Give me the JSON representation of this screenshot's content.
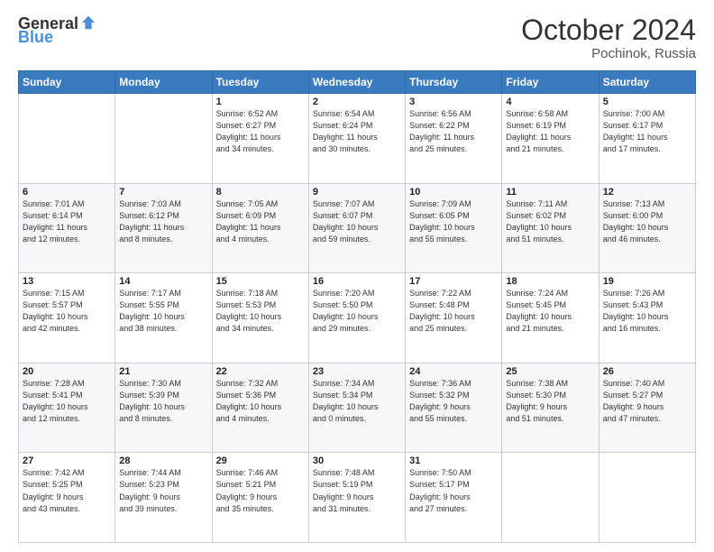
{
  "header": {
    "logo": {
      "general": "General",
      "blue": "Blue"
    },
    "title": "October 2024",
    "location": "Pochinok, Russia"
  },
  "calendar": {
    "days_of_week": [
      "Sunday",
      "Monday",
      "Tuesday",
      "Wednesday",
      "Thursday",
      "Friday",
      "Saturday"
    ],
    "weeks": [
      [
        {
          "day": "",
          "text": ""
        },
        {
          "day": "",
          "text": ""
        },
        {
          "day": "1",
          "text": "Sunrise: 6:52 AM\nSunset: 6:27 PM\nDaylight: 11 hours\nand 34 minutes."
        },
        {
          "day": "2",
          "text": "Sunrise: 6:54 AM\nSunset: 6:24 PM\nDaylight: 11 hours\nand 30 minutes."
        },
        {
          "day": "3",
          "text": "Sunrise: 6:56 AM\nSunset: 6:22 PM\nDaylight: 11 hours\nand 25 minutes."
        },
        {
          "day": "4",
          "text": "Sunrise: 6:58 AM\nSunset: 6:19 PM\nDaylight: 11 hours\nand 21 minutes."
        },
        {
          "day": "5",
          "text": "Sunrise: 7:00 AM\nSunset: 6:17 PM\nDaylight: 11 hours\nand 17 minutes."
        }
      ],
      [
        {
          "day": "6",
          "text": "Sunrise: 7:01 AM\nSunset: 6:14 PM\nDaylight: 11 hours\nand 12 minutes."
        },
        {
          "day": "7",
          "text": "Sunrise: 7:03 AM\nSunset: 6:12 PM\nDaylight: 11 hours\nand 8 minutes."
        },
        {
          "day": "8",
          "text": "Sunrise: 7:05 AM\nSunset: 6:09 PM\nDaylight: 11 hours\nand 4 minutes."
        },
        {
          "day": "9",
          "text": "Sunrise: 7:07 AM\nSunset: 6:07 PM\nDaylight: 10 hours\nand 59 minutes."
        },
        {
          "day": "10",
          "text": "Sunrise: 7:09 AM\nSunset: 6:05 PM\nDaylight: 10 hours\nand 55 minutes."
        },
        {
          "day": "11",
          "text": "Sunrise: 7:11 AM\nSunset: 6:02 PM\nDaylight: 10 hours\nand 51 minutes."
        },
        {
          "day": "12",
          "text": "Sunrise: 7:13 AM\nSunset: 6:00 PM\nDaylight: 10 hours\nand 46 minutes."
        }
      ],
      [
        {
          "day": "13",
          "text": "Sunrise: 7:15 AM\nSunset: 5:57 PM\nDaylight: 10 hours\nand 42 minutes."
        },
        {
          "day": "14",
          "text": "Sunrise: 7:17 AM\nSunset: 5:55 PM\nDaylight: 10 hours\nand 38 minutes."
        },
        {
          "day": "15",
          "text": "Sunrise: 7:18 AM\nSunset: 5:53 PM\nDaylight: 10 hours\nand 34 minutes."
        },
        {
          "day": "16",
          "text": "Sunrise: 7:20 AM\nSunset: 5:50 PM\nDaylight: 10 hours\nand 29 minutes."
        },
        {
          "day": "17",
          "text": "Sunrise: 7:22 AM\nSunset: 5:48 PM\nDaylight: 10 hours\nand 25 minutes."
        },
        {
          "day": "18",
          "text": "Sunrise: 7:24 AM\nSunset: 5:45 PM\nDaylight: 10 hours\nand 21 minutes."
        },
        {
          "day": "19",
          "text": "Sunrise: 7:26 AM\nSunset: 5:43 PM\nDaylight: 10 hours\nand 16 minutes."
        }
      ],
      [
        {
          "day": "20",
          "text": "Sunrise: 7:28 AM\nSunset: 5:41 PM\nDaylight: 10 hours\nand 12 minutes."
        },
        {
          "day": "21",
          "text": "Sunrise: 7:30 AM\nSunset: 5:39 PM\nDaylight: 10 hours\nand 8 minutes."
        },
        {
          "day": "22",
          "text": "Sunrise: 7:32 AM\nSunset: 5:36 PM\nDaylight: 10 hours\nand 4 minutes."
        },
        {
          "day": "23",
          "text": "Sunrise: 7:34 AM\nSunset: 5:34 PM\nDaylight: 10 hours\nand 0 minutes."
        },
        {
          "day": "24",
          "text": "Sunrise: 7:36 AM\nSunset: 5:32 PM\nDaylight: 9 hours\nand 55 minutes."
        },
        {
          "day": "25",
          "text": "Sunrise: 7:38 AM\nSunset: 5:30 PM\nDaylight: 9 hours\nand 51 minutes."
        },
        {
          "day": "26",
          "text": "Sunrise: 7:40 AM\nSunset: 5:27 PM\nDaylight: 9 hours\nand 47 minutes."
        }
      ],
      [
        {
          "day": "27",
          "text": "Sunrise: 7:42 AM\nSunset: 5:25 PM\nDaylight: 9 hours\nand 43 minutes."
        },
        {
          "day": "28",
          "text": "Sunrise: 7:44 AM\nSunset: 5:23 PM\nDaylight: 9 hours\nand 39 minutes."
        },
        {
          "day": "29",
          "text": "Sunrise: 7:46 AM\nSunset: 5:21 PM\nDaylight: 9 hours\nand 35 minutes."
        },
        {
          "day": "30",
          "text": "Sunrise: 7:48 AM\nSunset: 5:19 PM\nDaylight: 9 hours\nand 31 minutes."
        },
        {
          "day": "31",
          "text": "Sunrise: 7:50 AM\nSunset: 5:17 PM\nDaylight: 9 hours\nand 27 minutes."
        },
        {
          "day": "",
          "text": ""
        },
        {
          "day": "",
          "text": ""
        }
      ]
    ]
  }
}
